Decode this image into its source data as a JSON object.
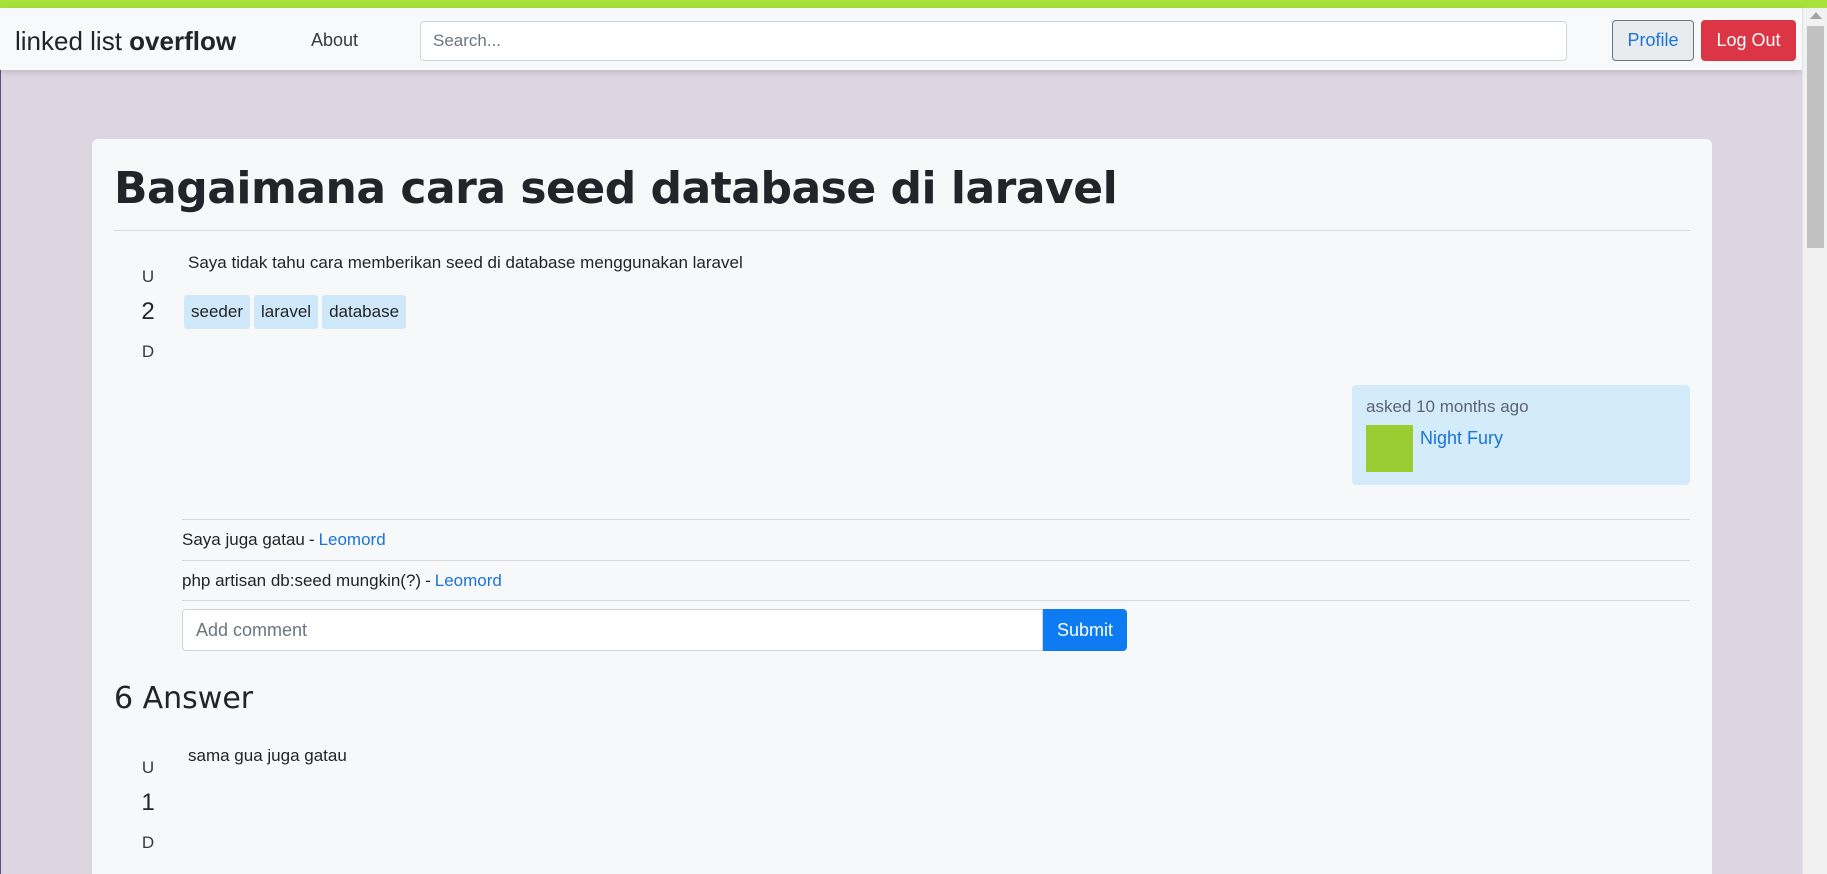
{
  "brand": {
    "light": "linked list ",
    "bold": "overflow"
  },
  "nav": {
    "about": "About",
    "search_placeholder": "Search...",
    "profile": "Profile",
    "logout": "Log Out"
  },
  "question": {
    "title": "Bagaimana cara seed database di laravel",
    "body": "Saya tidak tahu cara memberikan seed di database menggunakan laravel",
    "vote": {
      "up": "U",
      "count": "2",
      "down": "D"
    },
    "tags": [
      "seeder",
      "laravel",
      "database"
    ],
    "asked_label": "asked 10 months ago",
    "asker": "Night Fury",
    "comments": [
      {
        "text": "Saya juga gatau",
        "sep": "-",
        "author": "Leomord"
      },
      {
        "text": "php artisan db:seed mungkin(?)",
        "sep": "-",
        "author": "Leomord"
      }
    ],
    "comment_placeholder": "Add comment",
    "submit": "Submit"
  },
  "answers": {
    "heading": "6 Answer",
    "items": [
      {
        "body": "sama gua juga gatau",
        "vote": {
          "up": "U",
          "count": "1",
          "down": "D"
        }
      }
    ]
  },
  "colors": {
    "accent_bar": "#a7e23a",
    "background": "#ded5e2",
    "link": "#1a73d9",
    "danger": "#dc3545",
    "primary": "#0d7bf2",
    "avatar": "#9acd32"
  }
}
